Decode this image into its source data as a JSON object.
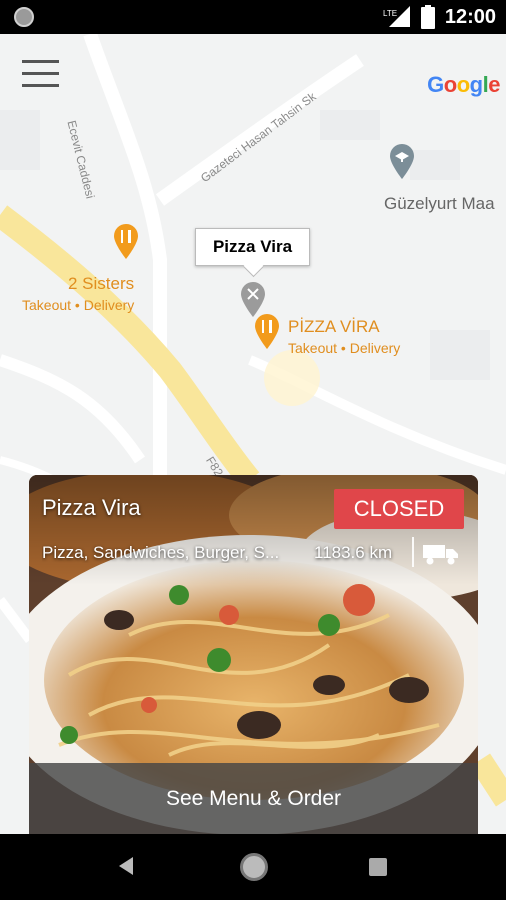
{
  "status_bar": {
    "network_label": "LTE",
    "time": "12:00"
  },
  "map": {
    "google_logo": [
      "G",
      "o",
      "o",
      "g",
      "l",
      "e"
    ],
    "google_colors": [
      "#4285F4",
      "#EA4335",
      "#FBBC05",
      "#4285F4",
      "#34A853",
      "#EA4335"
    ],
    "streets": {
      "street_1": "Ecevit Caddesi",
      "street_2": "Gazeteci Hasan Tahsin Sk",
      "street_3": "F82"
    },
    "pois": {
      "school": {
        "name": "Güzelyurt Maa"
      },
      "two_sisters": {
        "name": "2 Sisters",
        "sub": "Takeout • Delivery"
      },
      "pizza_vira": {
        "name": "PİZZA VİRA",
        "sub": "Takeout • Delivery"
      }
    },
    "callout_label": "Pizza Vira"
  },
  "card": {
    "name": "Pizza Vira",
    "status": "CLOSED",
    "cuisines": "Pizza, Sandwiches, Burger, S...",
    "distance": "1183.6 km",
    "action_label": "See Menu & Order",
    "status_color": "#e0464a"
  },
  "nav_bar": {
    "icons": [
      "back-icon",
      "home-icon",
      "recent-apps-icon"
    ]
  }
}
